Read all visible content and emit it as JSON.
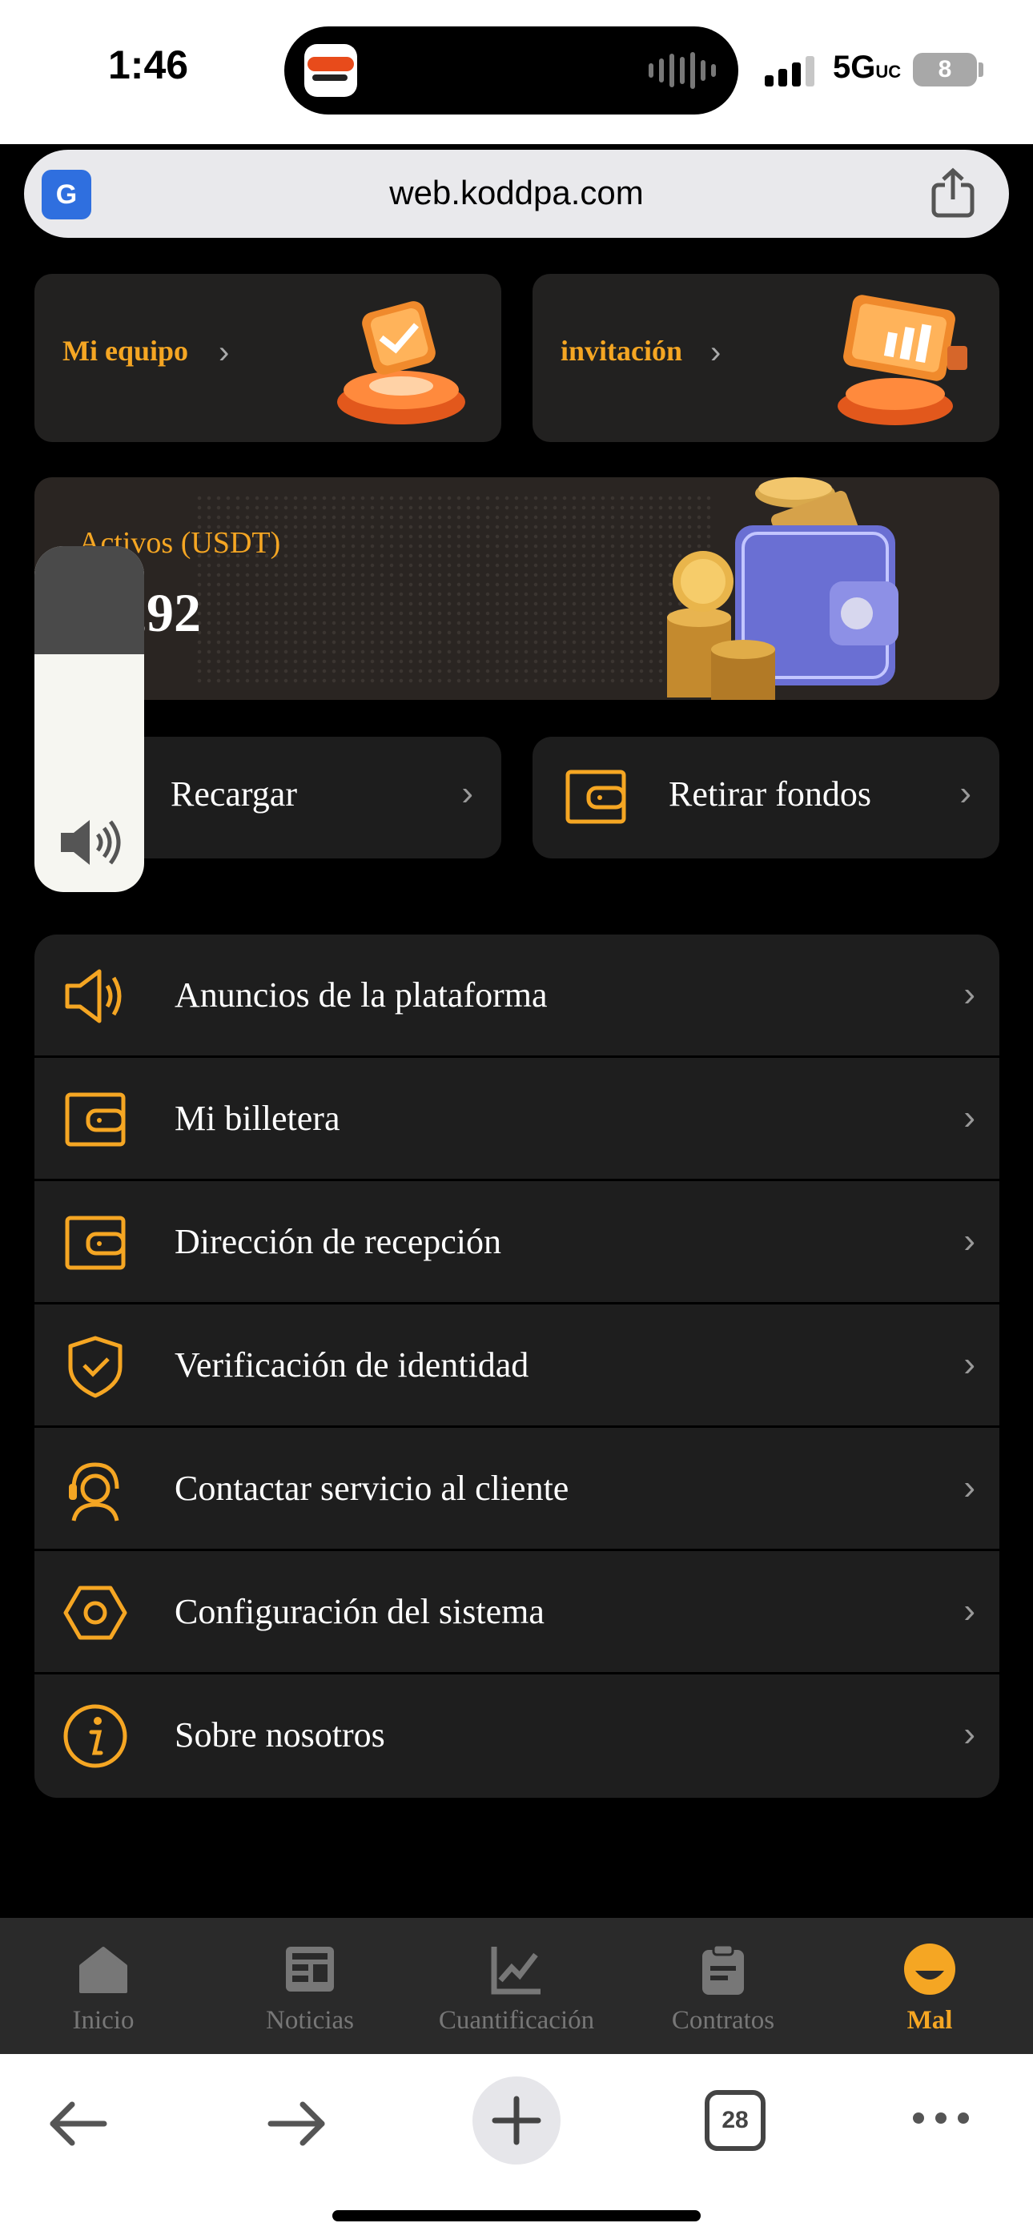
{
  "status_bar": {
    "time": "1:46",
    "network": "5G",
    "network_suffix": "UC",
    "battery": "8"
  },
  "browser": {
    "url": "web.koddpa.com",
    "translate_icon": "translate-icon",
    "share_icon": "share-icon",
    "open_tabs": "28"
  },
  "top_cards": {
    "team_label": "Mi equipo",
    "invite_label": "invitación"
  },
  "assets": {
    "label": "Activos (USDT)",
    "amount": "65,92"
  },
  "actions": {
    "recharge_label": "Recargar",
    "withdraw_label": "Retirar fondos"
  },
  "volume": {
    "level_percent": 70
  },
  "menu": {
    "items": [
      {
        "label": "Anuncios de la plataforma",
        "icon": "megaphone-icon"
      },
      {
        "label": "Mi billetera",
        "icon": "wallet-icon"
      },
      {
        "label": "Dirección de recepción",
        "icon": "wallet-icon"
      },
      {
        "label": "Verificación de identidad",
        "icon": "shield-check-icon"
      },
      {
        "label": "Contactar servicio al cliente",
        "icon": "headset-icon"
      },
      {
        "label": "Configuración del sistema",
        "icon": "settings-hexagon-icon"
      },
      {
        "label": "Sobre nosotros",
        "icon": "info-icon"
      }
    ]
  },
  "tabbar": {
    "items": [
      {
        "label": "Inicio",
        "icon": "home-icon"
      },
      {
        "label": "Noticias",
        "icon": "news-icon"
      },
      {
        "label": "Cuantificación",
        "icon": "chart-icon"
      },
      {
        "label": "Contratos",
        "icon": "clipboard-icon"
      },
      {
        "label": "Mal",
        "icon": "profile-icon"
      }
    ],
    "active_index": 4
  },
  "colors": {
    "accent": "#f5a623",
    "background": "#000000",
    "card": "#1e1e1e"
  }
}
